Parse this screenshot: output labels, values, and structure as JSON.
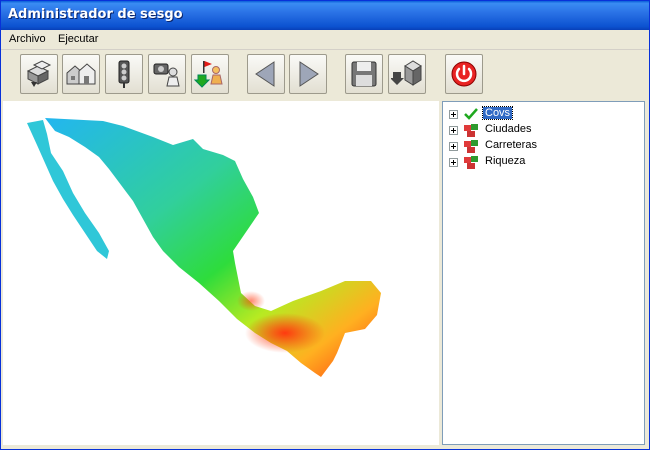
{
  "window": {
    "title": "Administrador de sesgo"
  },
  "menu": {
    "items": [
      {
        "label": "Archivo"
      },
      {
        "label": "Ejecutar"
      }
    ]
  },
  "toolbar": {
    "buttons": [
      {
        "icon": "stacked-boxes-icon"
      },
      {
        "icon": "houses-icon"
      },
      {
        "icon": "traffic-light-icon"
      },
      {
        "icon": "camera-figure-icon"
      },
      {
        "icon": "flag-person-import-icon"
      },
      {
        "icon": "arrow-left-icon"
      },
      {
        "icon": "arrow-right-icon"
      },
      {
        "icon": "floppy-disk-icon"
      },
      {
        "icon": "export-icon"
      },
      {
        "icon": "power-icon"
      }
    ]
  },
  "tree": {
    "items": [
      {
        "label": "Covs",
        "icon": "green-check-icon",
        "selected": true
      },
      {
        "label": "Ciudades",
        "icon": "layer-cubes-icon",
        "selected": false
      },
      {
        "label": "Carreteras",
        "icon": "layer-cubes-icon",
        "selected": false
      },
      {
        "label": "Riqueza",
        "icon": "layer-cubes-icon",
        "selected": false
      }
    ]
  },
  "colors": {
    "title_bar": "#0c52d0",
    "map_low": "#22b6f0",
    "map_mid": "#2edc3c",
    "map_high": "#ff3a10",
    "selection": "#316ac5"
  }
}
